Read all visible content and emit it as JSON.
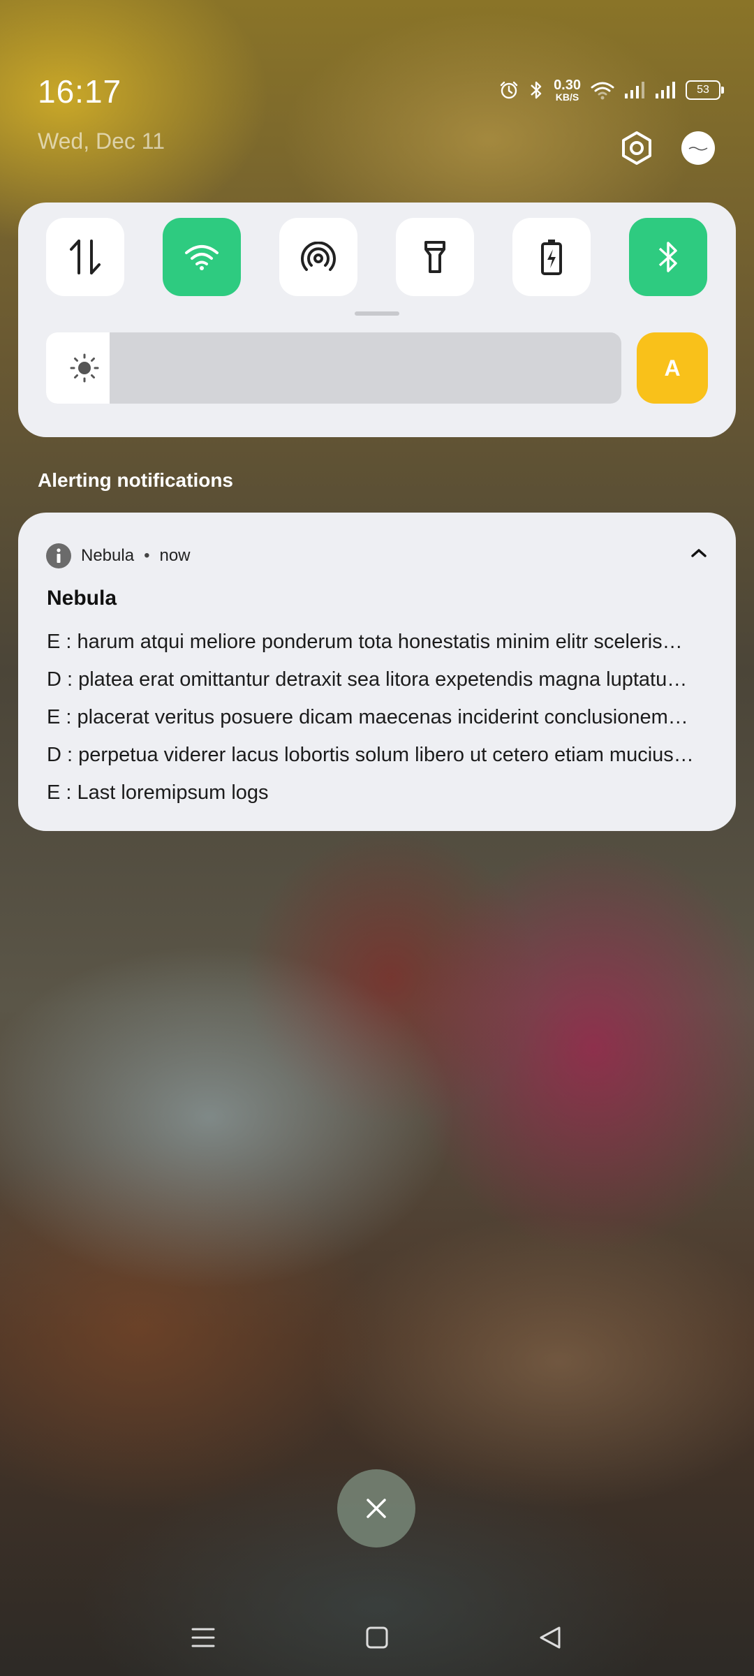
{
  "status_bar": {
    "time": "16:17",
    "date": "Wed, Dec 11",
    "net_speed_value": "0.30",
    "net_speed_unit": "KB/S",
    "battery_level": "53",
    "icons": [
      "alarm-icon",
      "bluetooth-icon",
      "wifi-icon",
      "signal-icon",
      "signal-icon",
      "battery-icon"
    ]
  },
  "quick_settings": {
    "tiles": [
      {
        "name": "mobile-data",
        "icon": "data-arrows-icon",
        "active": false
      },
      {
        "name": "wifi",
        "icon": "wifi-icon",
        "active": true
      },
      {
        "name": "hotspot",
        "icon": "hotspot-icon",
        "active": false
      },
      {
        "name": "flashlight",
        "icon": "flashlight-icon",
        "active": false
      },
      {
        "name": "battery-saver",
        "icon": "battery-saver-icon",
        "active": false
      },
      {
        "name": "bluetooth",
        "icon": "bluetooth-icon",
        "active": true
      }
    ],
    "brightness_level": 0.11,
    "auto_brightness_label": "A"
  },
  "notifications": {
    "section_label": "Alerting notifications",
    "items": [
      {
        "app_name": "Nebula",
        "time": "now",
        "title": "Nebula",
        "lines": [
          "E : harum atqui meliore ponderum tota honestatis minim elitr sceleris…",
          "D : platea erat omittantur detraxit sea litora expetendis magna luptatu…",
          "E : placerat veritus posuere dicam maecenas inciderint conclusionem…",
          "D : perpetua viderer lacus lobortis solum libero ut cetero etiam mucius…",
          "E : Last loremipsum logs"
        ]
      }
    ]
  },
  "colors": {
    "accent_green": "#2ecb80",
    "auto_yellow": "#f9c11a",
    "panel_bg": "#eeeff3"
  }
}
